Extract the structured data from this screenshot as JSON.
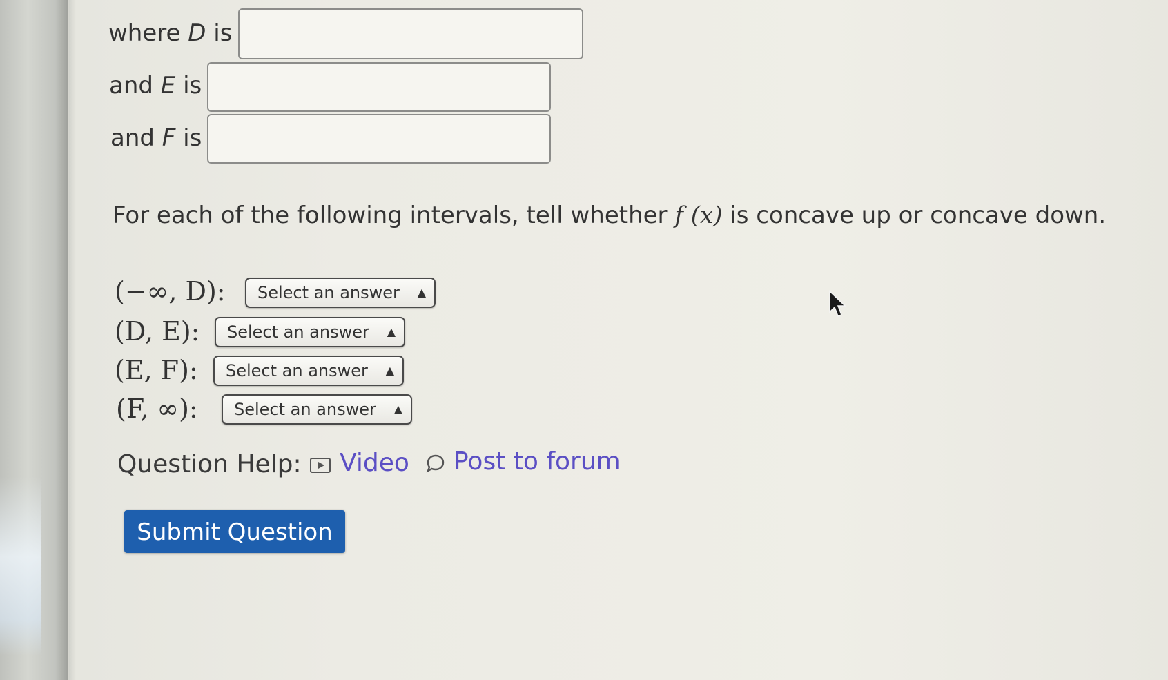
{
  "fields": [
    {
      "prefix": "where",
      "var": "D",
      "suffix": "is"
    },
    {
      "prefix": "and",
      "var": "E",
      "suffix": "is"
    },
    {
      "prefix": "and",
      "var": "F",
      "suffix": "is"
    }
  ],
  "instruction": {
    "before": "For each of the following intervals, tell whether",
    "func": "f (x)",
    "after": "is concave up or concave down."
  },
  "intervals": [
    {
      "label": "(−∞, D):",
      "select": "Select an answer"
    },
    {
      "label": "(D, E):",
      "select": "Select an answer"
    },
    {
      "label": "(E, F):",
      "select": "Select an answer"
    },
    {
      "label": "(F, ∞):",
      "select": "Select an answer"
    }
  ],
  "help": {
    "label": "Question Help:",
    "video": "Video",
    "forum": "Post to forum"
  },
  "submit_label": "Submit Question",
  "colors": {
    "submit_bg": "#1e5fae",
    "link": "#5b4fc4"
  }
}
